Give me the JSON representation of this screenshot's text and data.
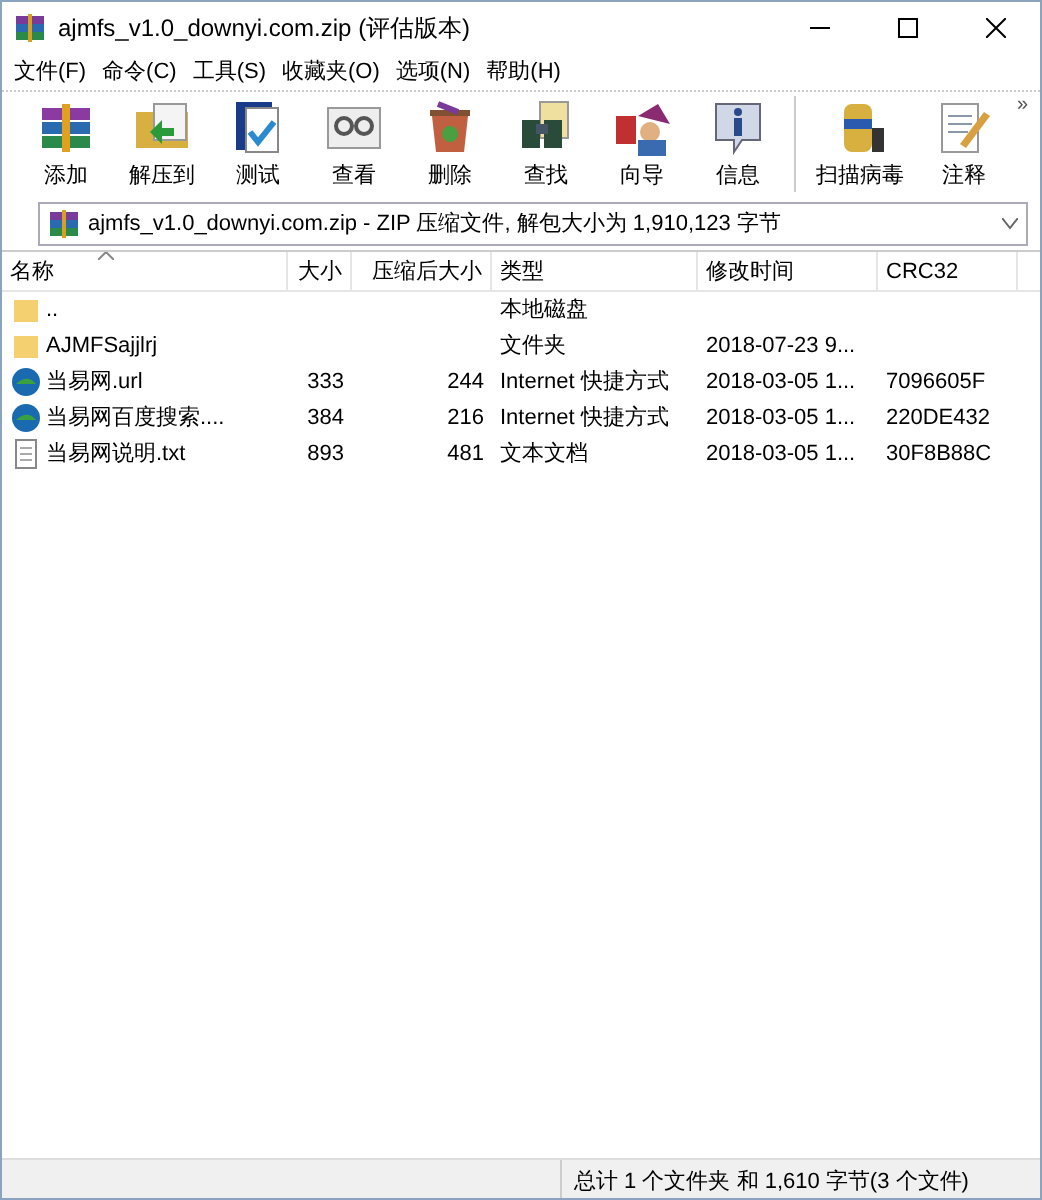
{
  "window": {
    "title": "ajmfs_v1.0_downyi.com.zip (评估版本)"
  },
  "menu": [
    "文件(F)",
    "命令(C)",
    "工具(S)",
    "收藏夹(O)",
    "选项(N)",
    "帮助(H)"
  ],
  "toolbar": [
    {
      "label": "添加",
      "kind": "add"
    },
    {
      "label": "解压到",
      "kind": "extract"
    },
    {
      "label": "测试",
      "kind": "test"
    },
    {
      "label": "查看",
      "kind": "view"
    },
    {
      "label": "删除",
      "kind": "delete"
    },
    {
      "label": "查找",
      "kind": "find"
    },
    {
      "label": "向导",
      "kind": "wizard"
    },
    {
      "label": "信息",
      "kind": "info"
    },
    {
      "label": "扫描病毒",
      "kind": "scan"
    },
    {
      "label": "注释",
      "kind": "comment"
    }
  ],
  "toolbar_more": "»",
  "path_field": {
    "value": "ajmfs_v1.0_downyi.com.zip - ZIP 压缩文件, 解包大小为 1,910,123 字节"
  },
  "table": {
    "columns": [
      "名称",
      "大小",
      "压缩后大小",
      "类型",
      "修改时间",
      "CRC32"
    ],
    "rows": [
      {
        "kind": "up",
        "name": "..",
        "size": "",
        "packed": "",
        "type": "本地磁盘",
        "modified": "",
        "crc": ""
      },
      {
        "kind": "folder",
        "name": "AJMFSajjlrj",
        "size": "",
        "packed": "",
        "type": "文件夹",
        "modified": "2018-07-23 9...",
        "crc": ""
      },
      {
        "kind": "url",
        "name": "当易网.url",
        "size": "333",
        "packed": "244",
        "type": "Internet 快捷方式",
        "modified": "2018-03-05 1...",
        "crc": "7096605F"
      },
      {
        "kind": "url",
        "name": "当易网百度搜索....",
        "size": "384",
        "packed": "216",
        "type": "Internet 快捷方式",
        "modified": "2018-03-05 1...",
        "crc": "220DE432"
      },
      {
        "kind": "txt",
        "name": "当易网说明.txt",
        "size": "893",
        "packed": "481",
        "type": "文本文档",
        "modified": "2018-03-05 1...",
        "crc": "30F8B88C"
      }
    ]
  },
  "status_bar": {
    "summary": "总计 1 个文件夹 和 1,610 字节(3 个文件)"
  }
}
